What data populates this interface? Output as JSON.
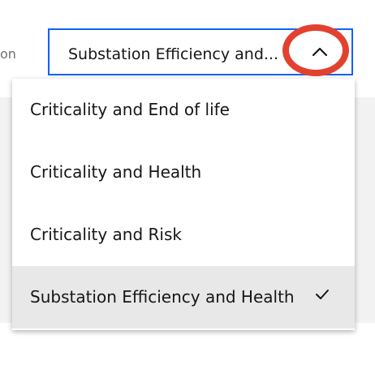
{
  "left_label": "on",
  "select": {
    "value": "Substation Efficiency and...",
    "expanded": true
  },
  "options": [
    {
      "label": "Criticality and End of life",
      "selected": false
    },
    {
      "label": "Criticality and Health",
      "selected": false
    },
    {
      "label": "Criticality and Risk",
      "selected": false
    },
    {
      "label": "Substation Efficiency and Health",
      "selected": true
    }
  ],
  "icons": {
    "chevron": "chevron-up-icon",
    "check": "checkmark-icon"
  },
  "colors": {
    "focus_border": "#0f62fe",
    "annotation": "#e3412f",
    "selected_bg": "#e8e8e8",
    "text": "#161616"
  }
}
